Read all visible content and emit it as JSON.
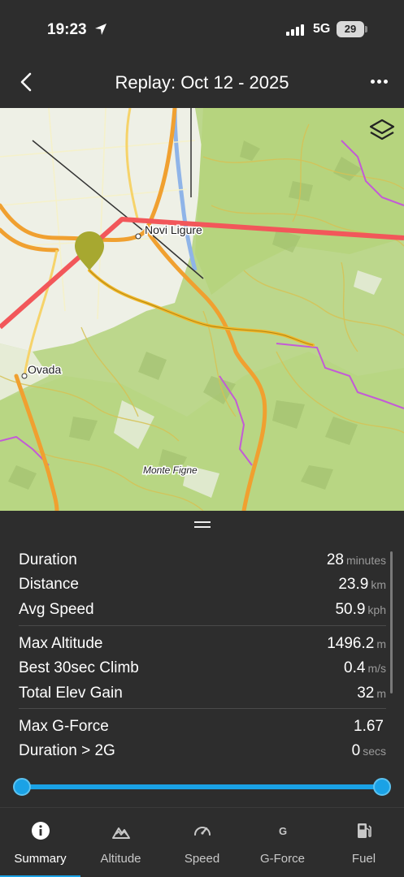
{
  "status_bar": {
    "time": "19:23",
    "network": "5G",
    "battery": "29"
  },
  "header": {
    "title": "Replay:  Oct 12 - 2025",
    "back_icon": "chevron-left-icon",
    "menu_icon": "more-horizontal-icon"
  },
  "map": {
    "labels": {
      "town1": "Novi Ligure",
      "town2": "Ovada",
      "peak": "Monte Figne"
    },
    "layers_icon": "layers-icon",
    "colors": {
      "track": "#f2b82a",
      "route": "#f2575a",
      "marker": "#a7a830"
    }
  },
  "stats": {
    "groups": [
      [
        {
          "label": "Duration",
          "value": "28",
          "unit": "minutes"
        },
        {
          "label": "Distance",
          "value": "23.9",
          "unit": "km"
        },
        {
          "label": "Avg Speed",
          "value": "50.9",
          "unit": "kph"
        }
      ],
      [
        {
          "label": "Max Altitude",
          "value": "1496.2",
          "unit": "m"
        },
        {
          "label": "Best 30sec Climb",
          "value": "0.4",
          "unit": "m/s"
        },
        {
          "label": "Total Elev Gain",
          "value": "32",
          "unit": "m"
        }
      ],
      [
        {
          "label": "Max G-Force",
          "value": "1.67",
          "unit": ""
        },
        {
          "label": "Duration > 2G",
          "value": "0",
          "unit": "secs"
        }
      ]
    ]
  },
  "replay_slider": {
    "start_fraction": 0.0,
    "end_fraction": 1.0,
    "color": "#1aa2e6"
  },
  "tabs": [
    {
      "label": "Summary",
      "icon": "info-icon",
      "active": true
    },
    {
      "label": "Altitude",
      "icon": "mountain-icon",
      "active": false
    },
    {
      "label": "Speed",
      "icon": "speedometer-icon",
      "active": false
    },
    {
      "label": "G-Force",
      "icon": "g-force-icon",
      "active": false
    },
    {
      "label": "Fuel",
      "icon": "fuel-pump-icon",
      "active": false
    }
  ]
}
